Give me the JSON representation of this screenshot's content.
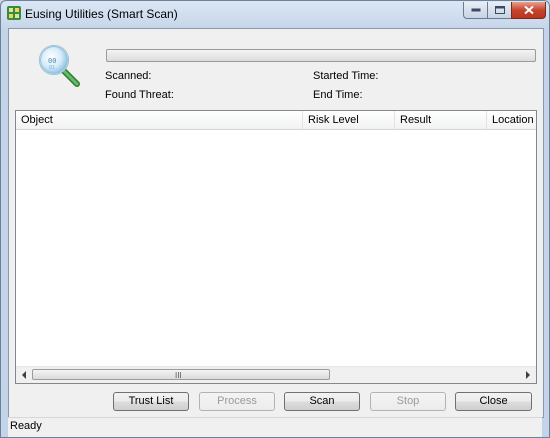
{
  "window": {
    "title": "Eusing Utilities (Smart Scan)"
  },
  "scan": {
    "progress_percent": 0,
    "scanned_label": "Scanned:",
    "found_threat_label": "Found Threat:",
    "started_time_label": "Started Time:",
    "end_time_label": "End Time:"
  },
  "results_table": {
    "columns": [
      "Object",
      "Risk Level",
      "Result",
      "Location"
    ],
    "rows": [],
    "scroll_grip": "III"
  },
  "buttons": {
    "trust_list": "Trust List",
    "process": "Process",
    "scan": "Scan",
    "stop": "Stop",
    "close": "Close"
  },
  "status": {
    "text": "Ready"
  },
  "colors": {
    "progress": "#37b34a",
    "title_close": "#c5452c"
  }
}
